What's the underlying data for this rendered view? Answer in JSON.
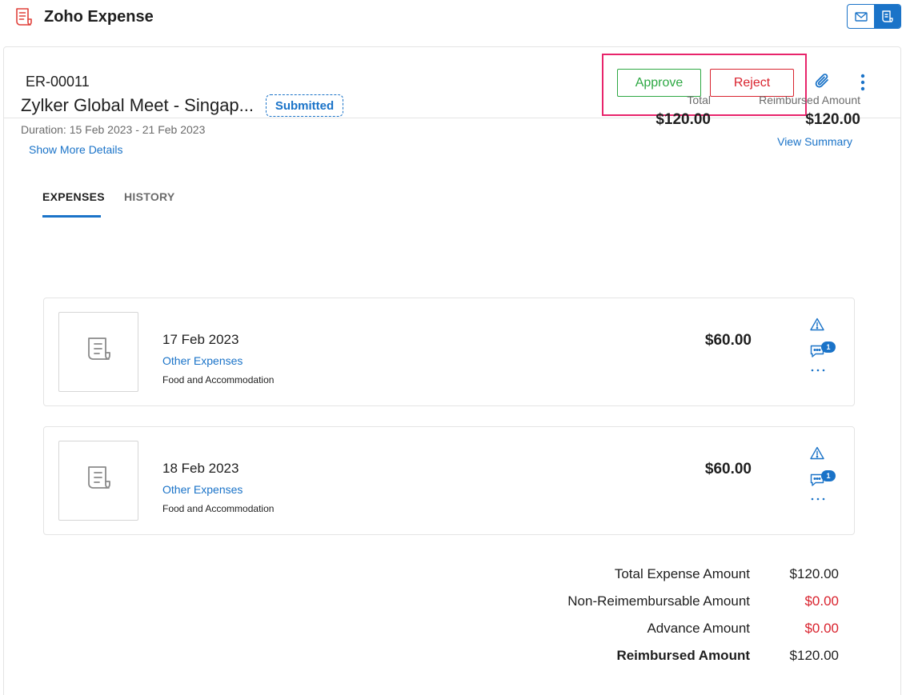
{
  "app": {
    "title": "Zoho Expense"
  },
  "report": {
    "id": "ER-00011",
    "actions": {
      "approve": "Approve",
      "reject": "Reject"
    },
    "trip_title": "Zylker Global Meet - Singap...",
    "status": "Submitted",
    "duration": "Duration: 15 Feb 2023 - 21 Feb 2023",
    "show_more": "Show More Details",
    "total_label": "Total",
    "total_value": "$120.00",
    "reimbursed_label": "Reimbursed Amount",
    "reimbursed_value": "$120.00",
    "view_summary": "View Summary"
  },
  "tabs": [
    {
      "label": "EXPENSES",
      "active": true
    },
    {
      "label": "HISTORY",
      "active": false
    }
  ],
  "expenses": [
    {
      "date": "17 Feb 2023",
      "category": "Other Expenses",
      "description": "Food and Accommodation",
      "amount": "$60.00",
      "comments": "1"
    },
    {
      "date": "18 Feb 2023",
      "category": "Other Expenses",
      "description": "Food and Accommodation",
      "amount": "$60.00",
      "comments": "1"
    }
  ],
  "summary": [
    {
      "label": "Total Expense Amount",
      "value": "$120.00"
    },
    {
      "label": "Non-Reimembursable Amount",
      "value": "$0.00"
    },
    {
      "label": "Advance Amount",
      "value": "$0.00"
    },
    {
      "label": "Reimbursed Amount",
      "value": "$120.00"
    }
  ],
  "colors": {
    "accent": "#1a73c8",
    "approve": "#2da843",
    "reject": "#d9232e",
    "highlight": "#e8246b",
    "negative_value": "#d9232e"
  },
  "icons": {
    "logo": "receipt-logo-icon",
    "switcher": [
      "mail-icon",
      "expense-app-icon"
    ],
    "attachment": "paperclip-icon",
    "menu": "vertical-dots-icon",
    "receipt": "receipt-placeholder-icon",
    "warning": "warning-icon",
    "comment": "comment-icon",
    "more": "horizontal-dots-icon"
  }
}
